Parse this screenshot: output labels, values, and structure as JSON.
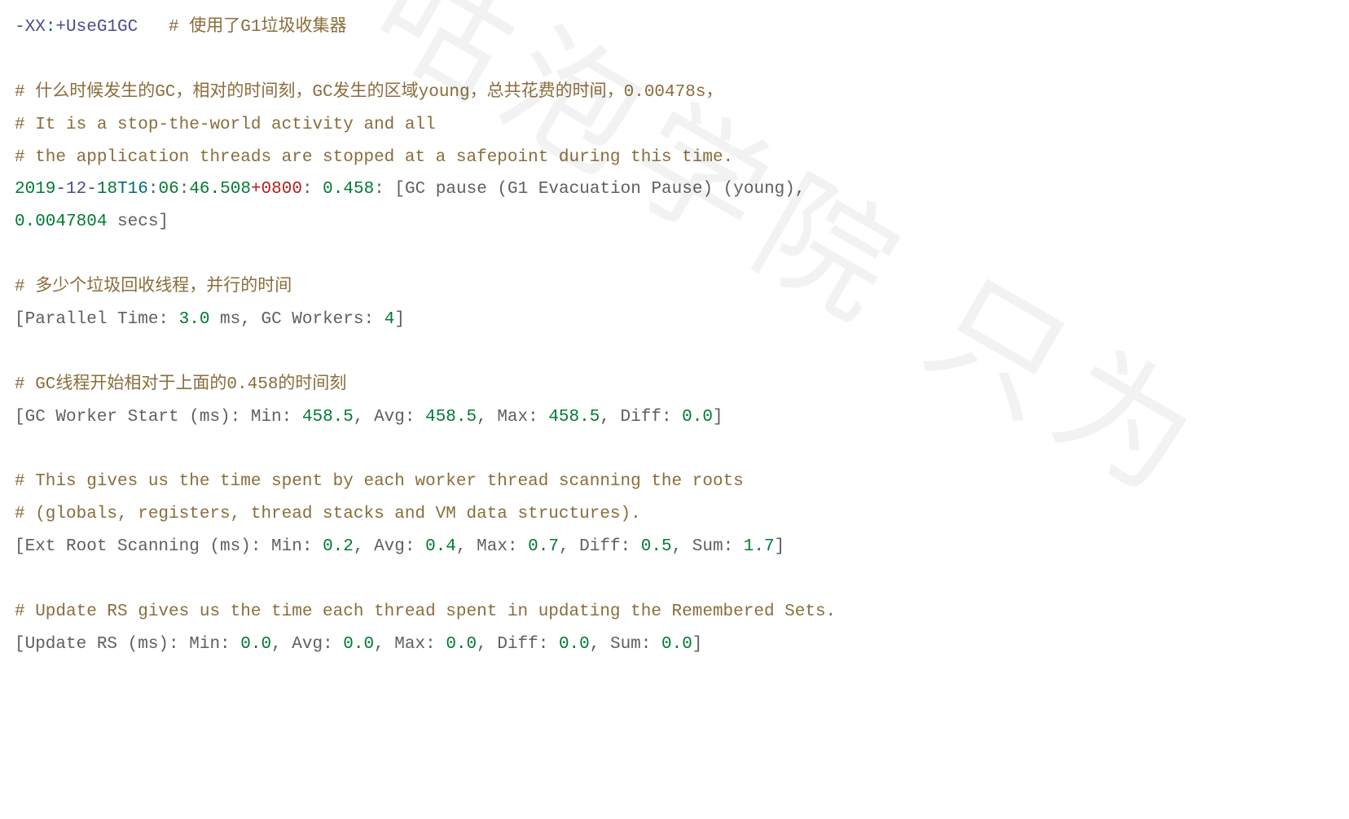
{
  "lines": {
    "l1a": "-XX",
    "l1b": ":",
    "l1c": "+UseG1GC",
    "l1d": "   # 使用了G1垃圾收集器",
    "blank": " ",
    "c1": "# 什么时候发生的GC，相对的时间刻，GC发生的区域young，总共花费的时间，0.00478s，",
    "c2": "# It is a stop-the-world activity and all",
    "c3": "# the application threads are stopped at a safepoint during this time.",
    "ts_a": "2019",
    "ts_b": "-12-",
    "ts_c": "18",
    "ts_d": "T16",
    "ts_e": ":",
    "ts_f": "06",
    "ts_g": ":",
    "ts_h": "46.508",
    "ts_i": "+0800",
    "ts_j": ": ",
    "ts_k": "0.458",
    "ts_l": ": [GC pause (G1 Evacuation Pause) (young), ",
    "ts_m": "0.0047804",
    "ts_n": " secs]",
    "c4": "# 多少个垃圾回收线程，并行的时间",
    "pt_a": "[Parallel Time: ",
    "pt_b": "3.0",
    "pt_c": " ms, GC Workers: ",
    "pt_d": "4",
    "pt_e": "]",
    "c5": "# GC线程开始相对于上面的0.458的时间刻",
    "gw_a": "[GC Worker Start (ms): Min: ",
    "gw_b": "458.5",
    "gw_c": ", Avg: ",
    "gw_d": "458.5",
    "gw_e": ", Max: ",
    "gw_f": "458.5",
    "gw_g": ", Diff: ",
    "gw_h": "0.0",
    "gw_i": "]",
    "c6": "# This gives us the time spent by each worker thread scanning the roots",
    "c7": "# (globals, registers, thread stacks and VM data structures).",
    "er_a": "[Ext Root Scanning (ms): Min: ",
    "er_b": "0.2",
    "er_c": ", Avg: ",
    "er_d": "0.4",
    "er_e": ", Max: ",
    "er_f": "0.7",
    "er_g": ", Diff: ",
    "er_h": "0.5",
    "er_i": ", Sum: ",
    "er_j": "1.7",
    "er_k": "]",
    "c8": "# Update RS gives us the time each thread spent in updating the Remembered Sets.",
    "ur_a": "[Update RS (ms): Min: ",
    "ur_b": "0.0",
    "ur_c": ", Avg: ",
    "ur_d": "0.0",
    "ur_e": ", Max: ",
    "ur_f": "0.0",
    "ur_g": ", Diff: ",
    "ur_h": "0.0",
    "ur_i": ", Sum: ",
    "ur_j": "0.0",
    "ur_k": "]"
  },
  "watermark": "咕泡学院 只为"
}
